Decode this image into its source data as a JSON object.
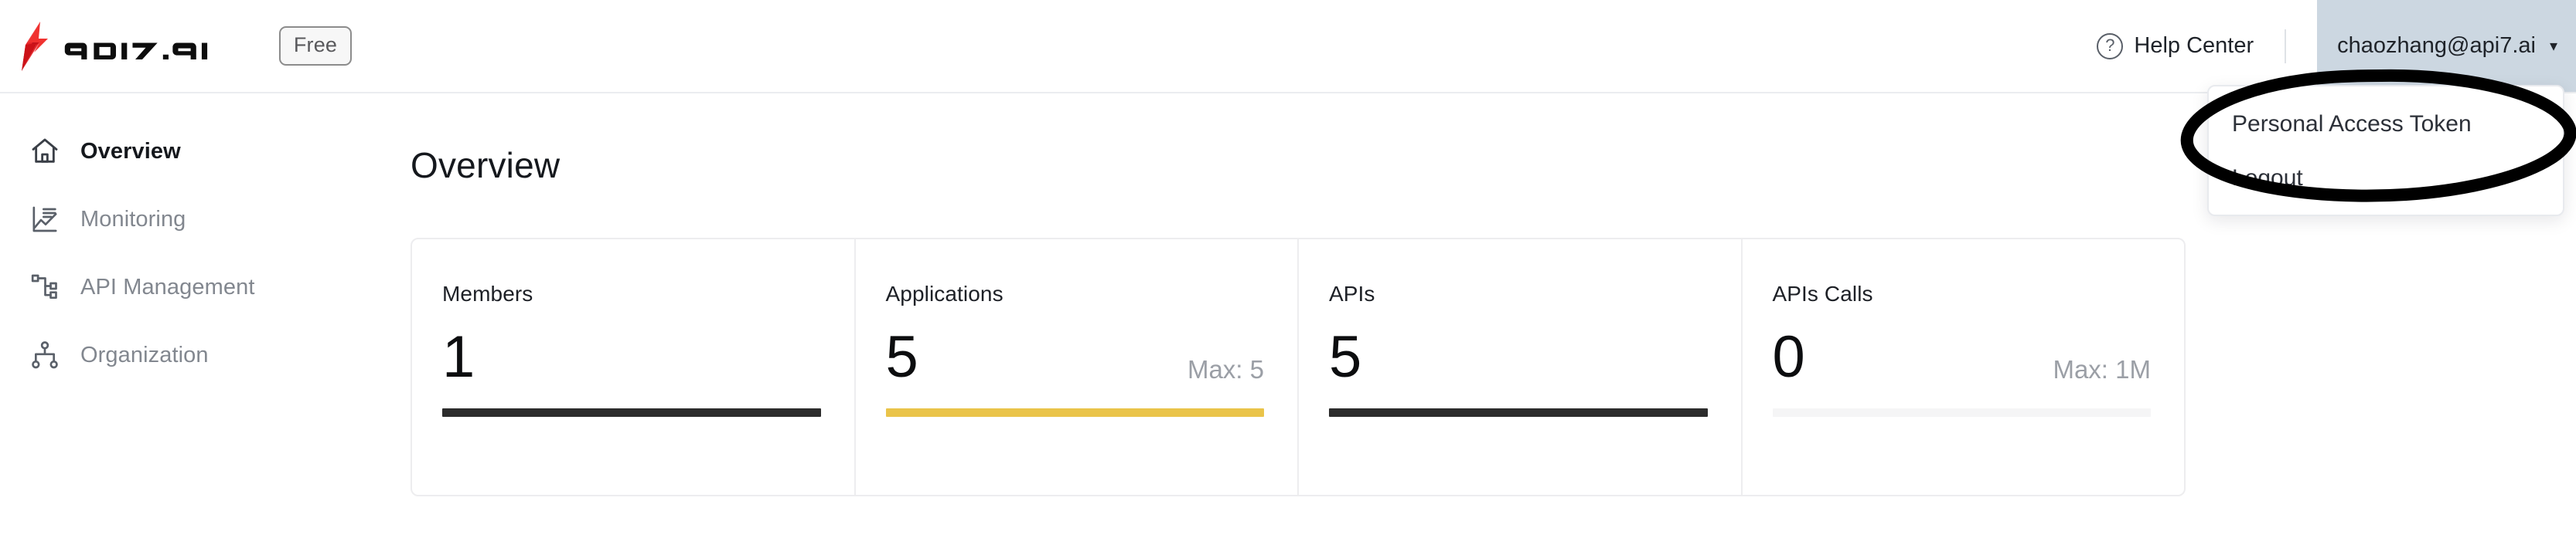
{
  "header": {
    "brand_name": "api7.ai",
    "plan_badge": "Free",
    "help_label": "Help Center",
    "help_icon": "question-circle-icon",
    "account_email": "chaozhang@api7.ai",
    "account_caret": "▾"
  },
  "user_menu": {
    "items": [
      {
        "label": "Personal Access Token"
      },
      {
        "label": "Logout"
      }
    ]
  },
  "annotation": {
    "shape": "ellipse",
    "color": "#000000",
    "targets": "Personal Access Token"
  },
  "sidebar": {
    "items": [
      {
        "label": "Overview",
        "icon": "home-icon",
        "active": true
      },
      {
        "label": "Monitoring",
        "icon": "chart-line-icon",
        "active": false
      },
      {
        "label": "API Management",
        "icon": "node-tree-icon",
        "active": false
      },
      {
        "label": "Organization",
        "icon": "org-chart-icon",
        "active": false
      }
    ]
  },
  "main": {
    "page_title": "Overview",
    "stat_cards": [
      {
        "label": "Members",
        "value": "1",
        "max": "",
        "bar_color": "#2c2c2c",
        "bar_fill": 100
      },
      {
        "label": "Applications",
        "value": "5",
        "max": "Max: 5",
        "bar_color": "#eac44a",
        "bar_fill": 100
      },
      {
        "label": "APIs",
        "value": "5",
        "max": "",
        "bar_color": "#2c2c2c",
        "bar_fill": 100
      },
      {
        "label": "APIs Calls",
        "value": "0",
        "max": "Max: 1M",
        "bar_color": "#f5f5f6",
        "bar_fill": 100
      }
    ]
  },
  "colors": {
    "accent_yellow": "#eac44a",
    "brand_red": "#e8252a",
    "dark_bar": "#2c2c2c",
    "empty_bar": "#f5f5f6",
    "selection_blue": "#ccd7e1"
  }
}
